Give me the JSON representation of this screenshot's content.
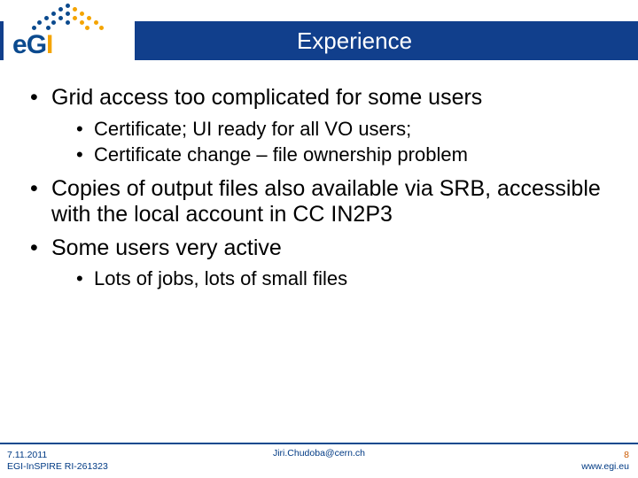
{
  "header": {
    "title": "Experience"
  },
  "bullets": {
    "b1": "Grid access too complicated for some users",
    "b1_1": "Certificate; UI ready for all VO users;",
    "b1_2": "Certificate change – file ownership problem",
    "b2": "Copies of output files also available via SRB, accessible with the local account in CC IN2P3",
    "b3": "Some users very active",
    "b3_1": "Lots of jobs, lots of small files"
  },
  "footer": {
    "date": "7.11.2011",
    "project": "EGI-InSPIRE RI-261323",
    "author": "Jiri.Chudoba@cern.ch",
    "page": "8",
    "url": "www.egi.eu"
  }
}
